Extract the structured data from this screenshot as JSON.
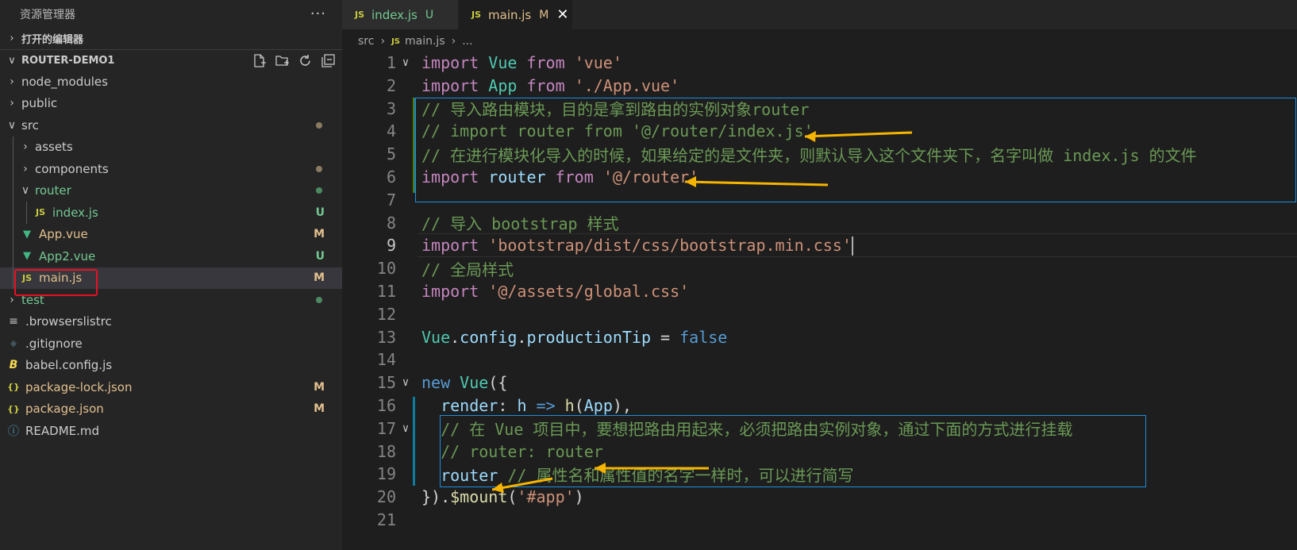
{
  "explorer": {
    "title": "资源管理器",
    "more": "···",
    "open_editors_label": "打开的编辑器",
    "project_label": "ROUTER-DEMO1",
    "tree": [
      {
        "label": "node_modules",
        "type": "folder",
        "expanded": false,
        "depth": 0,
        "status": ""
      },
      {
        "label": "public",
        "type": "folder",
        "expanded": false,
        "depth": 0,
        "status": ""
      },
      {
        "label": "src",
        "type": "folder",
        "expanded": true,
        "depth": 0,
        "status": "dot"
      },
      {
        "label": "assets",
        "type": "folder",
        "expanded": false,
        "depth": 1,
        "status": ""
      },
      {
        "label": "components",
        "type": "folder",
        "expanded": false,
        "depth": 1,
        "status": "dot"
      },
      {
        "label": "router",
        "type": "folder",
        "expanded": true,
        "depth": 1,
        "status": "dot-green"
      },
      {
        "label": "index.js",
        "type": "js",
        "depth": 2,
        "status": "U"
      },
      {
        "label": "App.vue",
        "type": "vue",
        "depth": 1,
        "status": "M"
      },
      {
        "label": "App2.vue",
        "type": "vue",
        "depth": 1,
        "status": "U"
      },
      {
        "label": "main.js",
        "type": "js",
        "depth": 1,
        "status": "M",
        "selected": true
      },
      {
        "label": "test",
        "type": "folder",
        "expanded": false,
        "depth": 0,
        "status": "dot-green"
      },
      {
        "label": ".browserslistrc",
        "type": "lines",
        "depth": 0,
        "status": ""
      },
      {
        "label": ".gitignore",
        "type": "git",
        "depth": 0,
        "status": ""
      },
      {
        "label": "babel.config.js",
        "type": "babel",
        "depth": 0,
        "status": ""
      },
      {
        "label": "package-lock.json",
        "type": "json",
        "depth": 0,
        "status": "M"
      },
      {
        "label": "package.json",
        "type": "json",
        "depth": 0,
        "status": "M"
      },
      {
        "label": "README.md",
        "type": "info",
        "depth": 0,
        "status": ""
      }
    ]
  },
  "tabs": [
    {
      "icon": "JS",
      "label": "index.js",
      "status": "U",
      "active": false
    },
    {
      "icon": "JS",
      "label": "main.js",
      "status": "M",
      "active": true,
      "close": "✕"
    }
  ],
  "breadcrumb": {
    "folder": "src",
    "file": "main.js",
    "more": "..."
  },
  "code": [
    {
      "n": "1",
      "fold": "∨",
      "tokens": [
        [
          "kw",
          "import"
        ],
        [
          "pl",
          " "
        ],
        [
          "id",
          "Vue"
        ],
        [
          "pl",
          " "
        ],
        [
          "kw",
          "from"
        ],
        [
          "pl",
          " "
        ],
        [
          "str",
          "'vue'"
        ]
      ]
    },
    {
      "n": "2",
      "tokens": [
        [
          "kw",
          "import"
        ],
        [
          "pl",
          " "
        ],
        [
          "id",
          "App"
        ],
        [
          "pl",
          " "
        ],
        [
          "kw",
          "from"
        ],
        [
          "pl",
          " "
        ],
        [
          "str",
          "'./App.vue'"
        ]
      ]
    },
    {
      "n": "3",
      "tokens": [
        [
          "cmt",
          "// 导入路由模块，目的是拿到路由的实例对象router"
        ]
      ]
    },
    {
      "n": "4",
      "tokens": [
        [
          "cmt",
          "// import router from '@/router/index.js'"
        ]
      ]
    },
    {
      "n": "5",
      "tokens": [
        [
          "cmt",
          "// 在进行模块化导入的时候，如果给定的是文件夹，则默认导入这个文件夹下，名字叫做 index.js 的文件"
        ]
      ]
    },
    {
      "n": "6",
      "tokens": [
        [
          "kw",
          "import"
        ],
        [
          "pl",
          " "
        ],
        [
          "prop",
          "router"
        ],
        [
          "pl",
          " "
        ],
        [
          "kw",
          "from"
        ],
        [
          "pl",
          " "
        ],
        [
          "str",
          "'@/router'"
        ]
      ]
    },
    {
      "n": "7",
      "tokens": []
    },
    {
      "n": "8",
      "tokens": [
        [
          "cmt",
          "// 导入 bootstrap 样式"
        ]
      ]
    },
    {
      "n": "9",
      "current": true,
      "tokens": [
        [
          "kw",
          "import"
        ],
        [
          "pl",
          " "
        ],
        [
          "str",
          "'bootstrap/dist/css/bootstrap.min.css'"
        ]
      ]
    },
    {
      "n": "10",
      "tokens": [
        [
          "cmt",
          "// 全局样式"
        ]
      ]
    },
    {
      "n": "11",
      "tokens": [
        [
          "kw",
          "import"
        ],
        [
          "pl",
          " "
        ],
        [
          "str",
          "'@/assets/global.css'"
        ]
      ]
    },
    {
      "n": "12",
      "tokens": []
    },
    {
      "n": "13",
      "tokens": [
        [
          "id",
          "Vue"
        ],
        [
          "pl",
          "."
        ],
        [
          "prop",
          "config"
        ],
        [
          "pl",
          "."
        ],
        [
          "prop",
          "productionTip"
        ],
        [
          "pl",
          " = "
        ],
        [
          "bool",
          "false"
        ]
      ]
    },
    {
      "n": "14",
      "tokens": []
    },
    {
      "n": "15",
      "fold": "∨",
      "tokens": [
        [
          "bool",
          "new"
        ],
        [
          "pl",
          " "
        ],
        [
          "id",
          "Vue"
        ],
        [
          "pl",
          "({"
        ]
      ]
    },
    {
      "n": "16",
      "tokens": [
        [
          "pl",
          "  "
        ],
        [
          "prop",
          "render"
        ],
        [
          "pl",
          ": "
        ],
        [
          "prop",
          "h"
        ],
        [
          "pl",
          " "
        ],
        [
          "bool",
          "=>"
        ],
        [
          "pl",
          " "
        ],
        [
          "fn",
          "h"
        ],
        [
          "pl",
          "("
        ],
        [
          "prop",
          "App"
        ],
        [
          "pl",
          "),"
        ]
      ]
    },
    {
      "n": "17",
      "fold": "∨",
      "tokens": [
        [
          "pl",
          "  "
        ],
        [
          "cmt",
          "// 在 Vue 项目中，要想把路由用起来，必须把路由实例对象，通过下面的方式进行挂载"
        ]
      ]
    },
    {
      "n": "18",
      "tokens": [
        [
          "pl",
          "  "
        ],
        [
          "cmt",
          "// router: router"
        ]
      ]
    },
    {
      "n": "19",
      "tokens": [
        [
          "pl",
          "  "
        ],
        [
          "prop",
          "router"
        ],
        [
          "pl",
          " "
        ],
        [
          "cmt",
          "// 属性名和属性值的名字一样时，可以进行简写"
        ]
      ]
    },
    {
      "n": "20",
      "tokens": [
        [
          "pl",
          "})."
        ],
        [
          "fn",
          "$mount"
        ],
        [
          "pl",
          "("
        ],
        [
          "str",
          "'#app'"
        ],
        [
          "pl",
          ")"
        ]
      ]
    },
    {
      "n": "21",
      "tokens": []
    }
  ],
  "colors": {
    "modified": "#e2c08d",
    "untracked": "#73c991",
    "annotation_box": "#1b8fe0",
    "annotation_arrow": "#f5b400",
    "selection_box": "#e81123"
  }
}
